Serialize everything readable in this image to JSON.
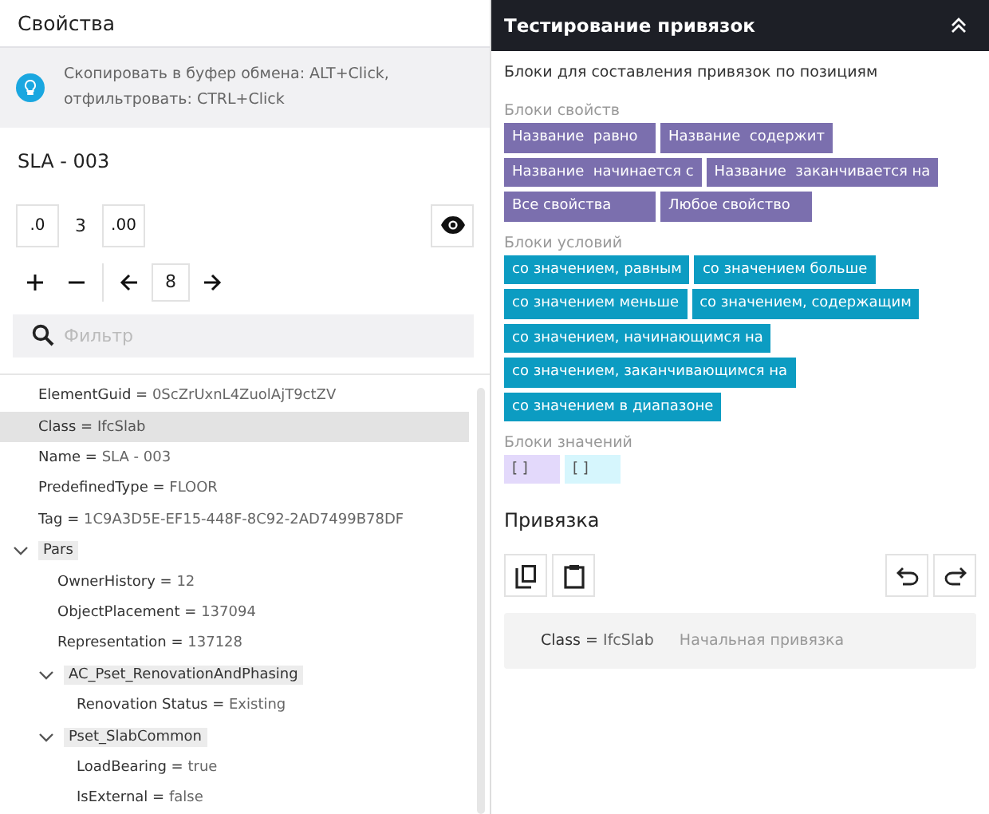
{
  "left_panel": {
    "title": "Свойства",
    "hint": "Скопировать в буфер обмена: ALT+Click, отфильтровать: CTRL+Click",
    "element_name": "SLA - 003",
    "precision": {
      "decrease_label": ".0",
      "value": "3",
      "increase_label": ".00"
    },
    "depth": {
      "value": "8"
    },
    "filter": {
      "placeholder": "Фильтр"
    },
    "tree": [
      {
        "kind": "property",
        "key": "ElementGuid =",
        "value": "0ScZrUxnL4ZuolAjT9ctZV",
        "selected": false
      },
      {
        "kind": "property",
        "key": "Class =",
        "value": "IfcSlab",
        "selected": true
      },
      {
        "kind": "property",
        "key": "Name =",
        "value": "SLA - 003",
        "selected": false
      },
      {
        "kind": "property",
        "key": "PredefinedType =",
        "value": "FLOOR",
        "selected": false
      },
      {
        "kind": "property",
        "key": "Tag =",
        "value": "1C9A3D5E-EF15-448F-8C92-2AD7499B78DF",
        "selected": false
      },
      {
        "kind": "group",
        "label": "Pars",
        "expanded": true,
        "children": [
          {
            "kind": "property",
            "key": "OwnerHistory =",
            "value": "12",
            "selected": false
          },
          {
            "kind": "property",
            "key": "ObjectPlacement =",
            "value": "137094",
            "selected": false
          },
          {
            "kind": "property",
            "key": "Representation =",
            "value": "137128",
            "selected": false
          },
          {
            "kind": "group",
            "label": "AC_Pset_RenovationAndPhasing",
            "expanded": true,
            "children": [
              {
                "kind": "property",
                "key": "Renovation Status =",
                "value": "Existing",
                "selected": false
              }
            ]
          },
          {
            "kind": "group",
            "label": "Pset_SlabCommon",
            "expanded": true,
            "children": [
              {
                "kind": "property",
                "key": "LoadBearing =",
                "value": "true",
                "selected": false
              },
              {
                "kind": "property",
                "key": "IsExternal =",
                "value": "false",
                "selected": false
              }
            ]
          }
        ]
      }
    ]
  },
  "right_panel": {
    "title": "Тестирование привязок",
    "subtitle": "Блоки для составления привязок по позициям",
    "block_sections": [
      {
        "kind": "property",
        "title": "Блоки свойств",
        "blocks": [
          "Название  равно",
          "Название  содержит",
          "Название  начинается с",
          "Название  заканчивается на",
          "Все свойства",
          "Любое свойство"
        ]
      },
      {
        "kind": "condition",
        "title": "Блоки условий",
        "blocks": [
          "со значением, равным",
          "со значением больше",
          "со значением меньше",
          "со значением, содержащим",
          "со значением, начинающимся на",
          "со значением, заканчивающимся на",
          "со значением в диапазоне"
        ]
      }
    ],
    "value_section": {
      "title": "Блоки значений",
      "blocks": [
        {
          "label": "[ ]",
          "color": "#e3d9fb"
        },
        {
          "label": "[ ]",
          "color": "#d6f6fd"
        }
      ]
    },
    "binding": {
      "title": "Привязка",
      "key": "Class =",
      "value": "IfcSlab",
      "note": "Начальная привязка"
    }
  }
}
